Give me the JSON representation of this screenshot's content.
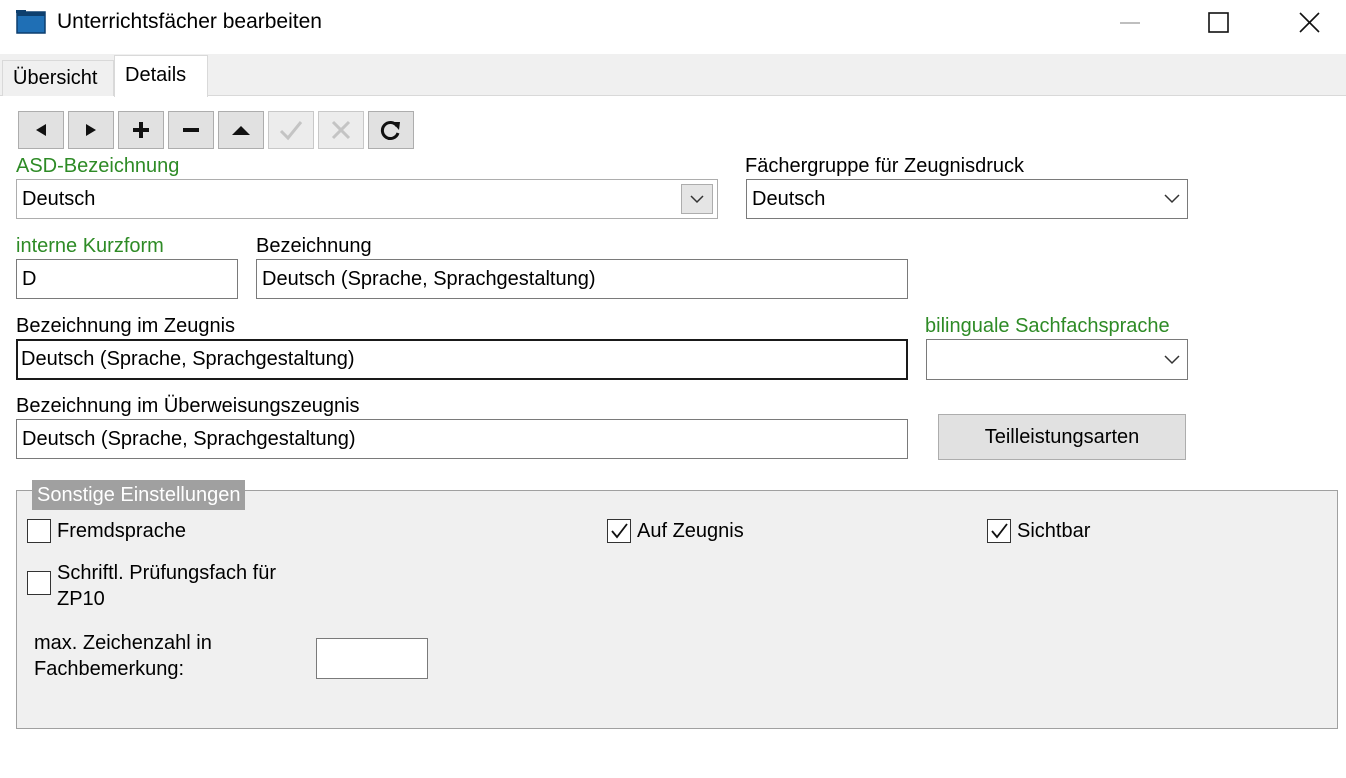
{
  "window": {
    "title": "Unterrichtsfächer bearbeiten",
    "icon": "app-window-icon",
    "controls": [
      "minimize-icon",
      "maximize-icon",
      "close-icon"
    ]
  },
  "tabs": [
    {
      "label": "Übersicht",
      "active": false
    },
    {
      "label": "Details",
      "active": true
    }
  ],
  "toolbar": {
    "buttons": [
      {
        "icon": "previous-icon",
        "enabled": true
      },
      {
        "icon": "next-icon",
        "enabled": true
      },
      {
        "icon": "add-icon",
        "enabled": true
      },
      {
        "icon": "remove-icon",
        "enabled": true
      },
      {
        "icon": "first-icon",
        "enabled": true
      },
      {
        "icon": "confirm-icon",
        "enabled": false
      },
      {
        "icon": "cancel-icon",
        "enabled": false
      },
      {
        "icon": "refresh-icon",
        "enabled": true
      }
    ]
  },
  "form": {
    "asd_label": "ASD-Bezeichnung",
    "asd_value": "Deutsch",
    "faechergruppe_label": "Fächergruppe für Zeugnisdruck",
    "faechergruppe_value": "Deutsch",
    "kurzform_label": "interne Kurzform",
    "kurzform_value": "D",
    "bezeichnung_label": "Bezeichnung",
    "bezeichnung_value": "Deutsch (Sprache, Sprachgestaltung)",
    "zeugnis_label": "Bezeichnung im Zeugnis",
    "zeugnis_value": "Deutsch (Sprache, Sprachgestaltung)",
    "bilingual_label": "bilinguale Sachfachsprache",
    "bilingual_value": "",
    "ueberweisung_label": "Bezeichnung im Überweisungszeugnis",
    "ueberweisung_value": "Deutsch (Sprache, Sprachgestaltung)",
    "teilleistung_button": "Teilleistungsarten"
  },
  "group": {
    "title": "Sonstige Einstellungen",
    "fremdsprache": {
      "label": "Fremdsprache",
      "checked": false
    },
    "auf_zeugnis": {
      "label": "Auf Zeugnis",
      "checked": true
    },
    "sichtbar": {
      "label": "Sichtbar",
      "checked": true
    },
    "pruefungsfach": {
      "label_line1": "Schriftl. Prüfungsfach für",
      "label_line2": "ZP10",
      "checked": false
    },
    "max_zeichen_line1": "max. Zeichenzahl in",
    "max_zeichen_line2": "Fachbemerkung:",
    "max_zeichen_value": ""
  },
  "colors": {
    "required_label": "#2e8b26",
    "group_title_bg": "#a0a0a0",
    "group_bg": "#f0f0f0",
    "app_icon": "#1f6fb5"
  }
}
